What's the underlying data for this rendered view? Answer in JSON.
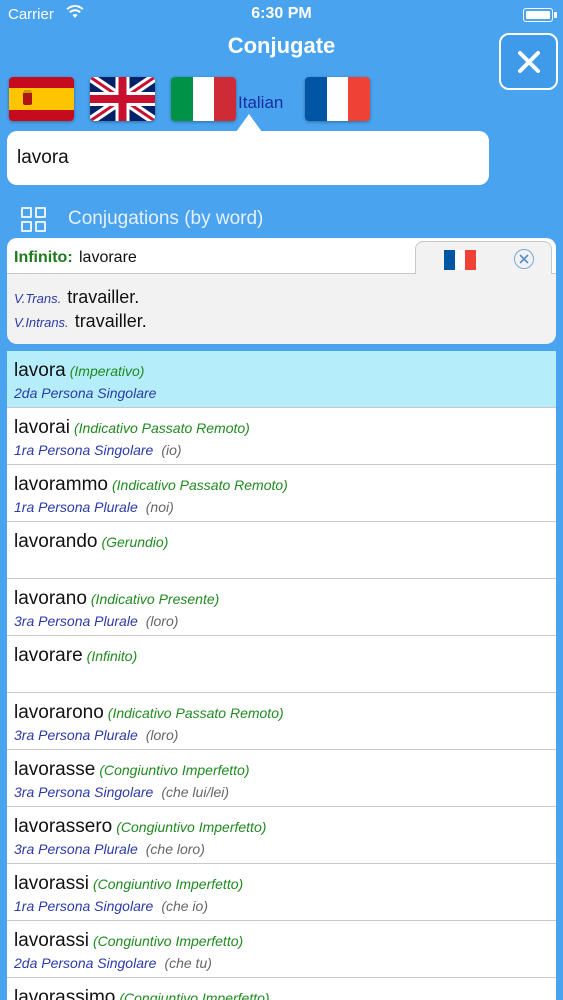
{
  "status": {
    "carrier": "Carrier",
    "time": "6:30 PM"
  },
  "nav": {
    "title": "Conjugate"
  },
  "flags": {
    "selected_label": "Italian",
    "items": [
      "spain-flag",
      "uk-flag",
      "italy-flag",
      "france-flag"
    ]
  },
  "search": {
    "value": "lavora",
    "placeholder": ""
  },
  "section": {
    "title": "Conjugations (by word)"
  },
  "definition": {
    "inf_label": "Infinito:",
    "inf_value": "lavorare",
    "lines": [
      {
        "pos": "V.Trans.",
        "text": "travailler."
      },
      {
        "pos": "V.Intrans.",
        "text": "travailler."
      }
    ]
  },
  "rows": [
    {
      "word": "lavora",
      "tense": "(Imperativo)",
      "person": "2da Persona Singolare",
      "pron": ""
    },
    {
      "word": "lavorai",
      "tense": "(Indicativo Passato Remoto)",
      "person": "1ra Persona Singolare",
      "pron": "(io)"
    },
    {
      "word": "lavorammo",
      "tense": "(Indicativo Passato Remoto)",
      "person": "1ra Persona Plurale",
      "pron": "(noi)"
    },
    {
      "word": "lavorando",
      "tense": "(Gerundio)",
      "person": "",
      "pron": ""
    },
    {
      "word": "lavorano",
      "tense": "(Indicativo Presente)",
      "person": "3ra Persona Plurale",
      "pron": "(loro)"
    },
    {
      "word": "lavorare",
      "tense": "(Infinito)",
      "person": "",
      "pron": ""
    },
    {
      "word": "lavorarono",
      "tense": "(Indicativo Passato Remoto)",
      "person": "3ra Persona Plurale",
      "pron": "(loro)"
    },
    {
      "word": "lavorasse",
      "tense": "(Congiuntivo Imperfetto)",
      "person": "3ra Persona Singolare",
      "pron": "(che lui/lei)"
    },
    {
      "word": "lavorassero",
      "tense": "(Congiuntivo Imperfetto)",
      "person": "3ra Persona Plurale",
      "pron": "(che loro)"
    },
    {
      "word": "lavorassi",
      "tense": "(Congiuntivo Imperfetto)",
      "person": "1ra Persona Singolare",
      "pron": "(che io)"
    },
    {
      "word": "lavorassi",
      "tense": "(Congiuntivo Imperfetto)",
      "person": "2da Persona Singolare",
      "pron": "(che tu)"
    },
    {
      "word": "lavorassimo",
      "tense": "(Congiuntivo Imperfetto)",
      "person": "",
      "pron": ""
    }
  ],
  "colors": {
    "background": "#4aa3ee",
    "selected_row": "#b5eefa",
    "tense": "#1f8a1f",
    "person": "#2b3aa8"
  }
}
